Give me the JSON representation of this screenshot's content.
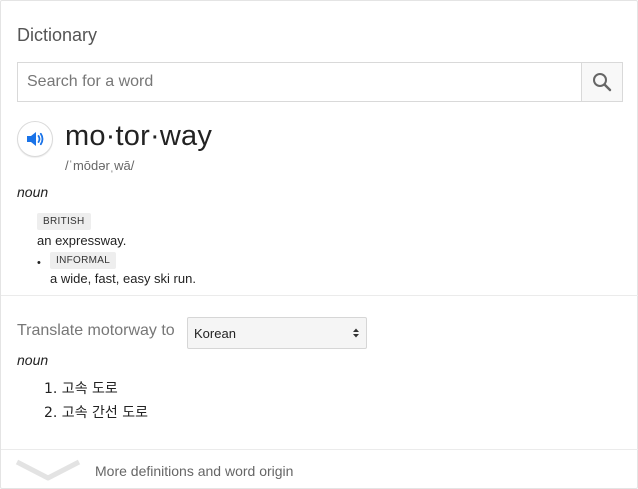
{
  "widget": {
    "title": "Dictionary",
    "search_placeholder": "Search for a word",
    "search_icon": "search-icon"
  },
  "entry": {
    "speaker_icon": "speaker-icon",
    "headword": "mo·tor·way",
    "phonetic": "/ˈmōdərˌwā/",
    "part_of_speech": "noun",
    "definitions": [
      {
        "label": "BRITISH",
        "text": "an expressway."
      },
      {
        "bullet": "•",
        "label": "INFORMAL",
        "text": "a wide, fast, easy ski run."
      }
    ]
  },
  "translate": {
    "label": "Translate motorway to",
    "language": "Korean",
    "part_of_speech": "noun",
    "items": [
      "1. 고속 도로",
      "2. 고속 간선 도로"
    ]
  },
  "footer": {
    "more_link": "More definitions and word origin",
    "chevron_icon": "chevron-down-icon"
  },
  "colors": {
    "accent_blue": "#1a73e8",
    "tag_bg": "#eeeeee",
    "muted_text": "#777777"
  }
}
